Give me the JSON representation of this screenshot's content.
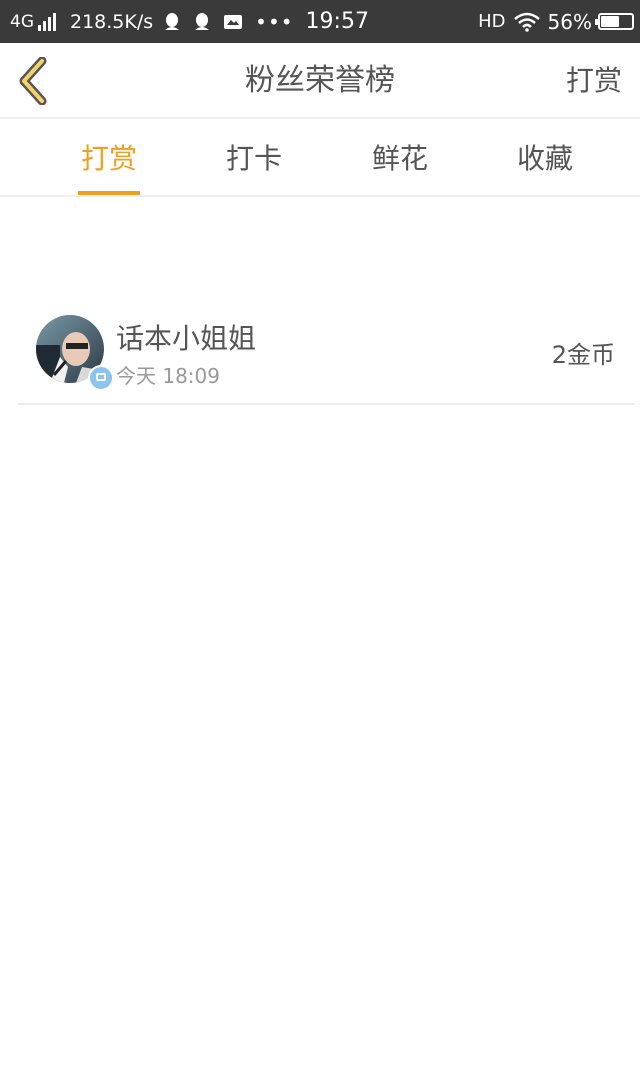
{
  "status_bar": {
    "network": "4G",
    "speed": "218.5K/s",
    "dots": "•••",
    "time": "19:57",
    "hd": "HD",
    "battery": "56%",
    "battery_level": 0.56,
    "icons": [
      "signal-icon",
      "qq-icon",
      "qq-icon",
      "mail-icon",
      "wifi-icon",
      "battery-icon"
    ]
  },
  "nav": {
    "title": "粉丝荣誉榜",
    "action": "打赏",
    "back_icon": "chevron-left-icon"
  },
  "tabs": [
    {
      "label": "打赏",
      "active": true
    },
    {
      "label": "打卡",
      "active": false
    },
    {
      "label": "鲜花",
      "active": false
    },
    {
      "label": "收藏",
      "active": false
    }
  ],
  "list": [
    {
      "name": "话本小姐姐",
      "time": "今天 18:09",
      "amount": "2金币"
    }
  ],
  "colors": {
    "accent": "#f0a020",
    "status_bar": "#3a3a3a",
    "text": "#555555",
    "muted": "#999999"
  }
}
